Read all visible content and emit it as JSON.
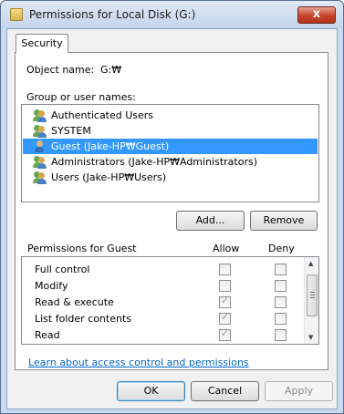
{
  "window": {
    "title": "Permissions for Local Disk (G:)",
    "close_glyph": "x"
  },
  "tabs": [
    "Security"
  ],
  "object": {
    "label": "Object name:",
    "value": "G:₩"
  },
  "groups": {
    "label": "Group or user names:",
    "items": [
      {
        "name": "Authenticated Users",
        "selected": false
      },
      {
        "name": "SYSTEM",
        "selected": false
      },
      {
        "name": "Guest (Jake-HP₩Guest)",
        "selected": true
      },
      {
        "name": "Administrators (Jake-HP₩Administrators)",
        "selected": false
      },
      {
        "name": "Users (Jake-HP₩Users)",
        "selected": false
      }
    ]
  },
  "buttons": {
    "add": "Add...",
    "remove": "Remove",
    "ok": "OK",
    "cancel": "Cancel",
    "apply": "Apply"
  },
  "permissions": {
    "label": "Permissions for Guest",
    "allow_header": "Allow",
    "deny_header": "Deny",
    "rows": [
      {
        "name": "Full control",
        "allow": false,
        "deny": false
      },
      {
        "name": "Modify",
        "allow": false,
        "deny": false
      },
      {
        "name": "Read & execute",
        "allow": true,
        "deny": false
      },
      {
        "name": "List folder contents",
        "allow": true,
        "deny": false
      },
      {
        "name": "Read",
        "allow": true,
        "deny": false
      }
    ]
  },
  "help_link": "Learn about access control and permissions",
  "colors": {
    "selection": "#3399ff",
    "link": "#0066cc",
    "close": "#c6422a"
  },
  "icons": [
    "folder-icon",
    "close-icon",
    "user-group-icon",
    "user-icon",
    "checkbox-check-icon",
    "scroll-up-icon",
    "scroll-down-icon"
  ]
}
